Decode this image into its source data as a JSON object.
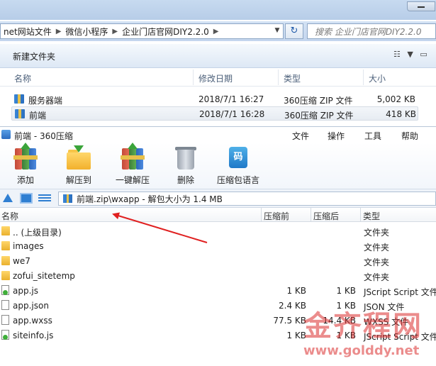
{
  "explorer": {
    "breadcrumb": [
      "net网站文件",
      "微信小程序",
      "企业门店官网DIY2.2.0"
    ],
    "search_placeholder": "搜索 企业门店官网DIY2.2.0",
    "new_folder_label": "新建文件夹",
    "columns": {
      "name": "名称",
      "modified": "修改日期",
      "type": "类型",
      "size": "大小"
    },
    "files": [
      {
        "name": "服务器端",
        "modified": "2018/7/1 16:27",
        "type": "360压缩 ZIP 文件",
        "size": "5,002 KB",
        "selected": false
      },
      {
        "name": "前端",
        "modified": "2018/7/1 16:28",
        "type": "360压缩 ZIP 文件",
        "size": "418 KB",
        "selected": true
      }
    ]
  },
  "zip": {
    "title": "前端 - 360压缩",
    "menu": [
      "文件",
      "操作",
      "工具",
      "帮助"
    ],
    "toolbar": [
      {
        "label": "添加",
        "icon": "add-archive-icon"
      },
      {
        "label": "解压到",
        "icon": "extract-to-icon"
      },
      {
        "label": "一键解压",
        "icon": "one-click-extract-icon"
      },
      {
        "label": "删除",
        "icon": "trash-icon"
      },
      {
        "label": "压缩包语言",
        "icon": "archive-language-icon",
        "glyph": "码"
      }
    ],
    "path_text": "前端.zip\\wxapp - 解包大小为 1.4 MB",
    "columns": {
      "name": "名称",
      "packed": "压缩前",
      "unpacked": "压缩后",
      "type": "类型"
    },
    "rows": [
      {
        "name": ".. (上级目录)",
        "packed": "",
        "unpacked": "",
        "type": "文件夹",
        "icon": "folder"
      },
      {
        "name": "images",
        "packed": "",
        "unpacked": "",
        "type": "文件夹",
        "icon": "folder"
      },
      {
        "name": "we7",
        "packed": "",
        "unpacked": "",
        "type": "文件夹",
        "icon": "folder"
      },
      {
        "name": "zofui_sitetemp",
        "packed": "",
        "unpacked": "",
        "type": "文件夹",
        "icon": "folder"
      },
      {
        "name": "app.js",
        "packed": "1 KB",
        "unpacked": "1 KB",
        "type": "JScript Script 文件",
        "icon": "js"
      },
      {
        "name": "app.json",
        "packed": "2.4 KB",
        "unpacked": "1 KB",
        "type": "JSON 文件",
        "icon": "file"
      },
      {
        "name": "app.wxss",
        "packed": "77.5 KB",
        "unpacked": "14.4 KB",
        "type": "WXSS 文件",
        "icon": "file"
      },
      {
        "name": "siteinfo.js",
        "packed": "1 KB",
        "unpacked": "1 KB",
        "type": "JScript Script 文件",
        "icon": "js"
      }
    ]
  },
  "watermark": {
    "text": "金齐程网",
    "url": "www.golddy.net"
  }
}
